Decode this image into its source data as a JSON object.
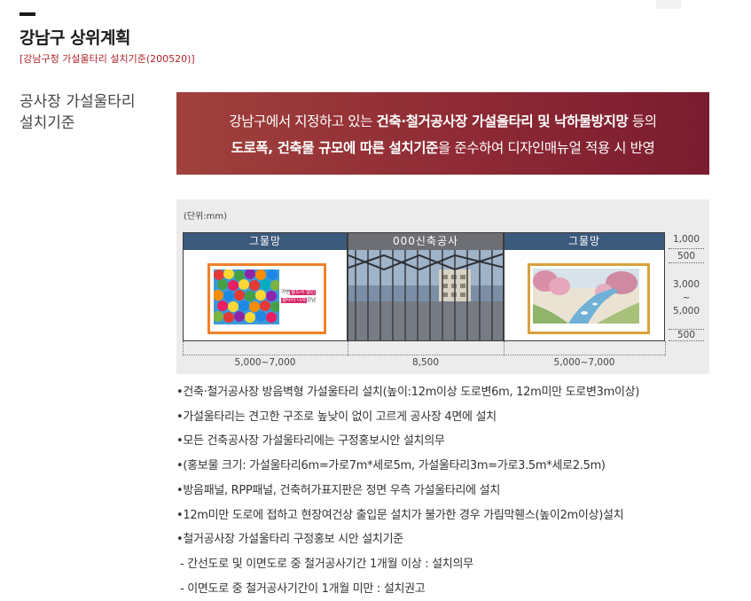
{
  "header": {
    "title": "강남구 상위계획",
    "subtitle": "[강남구청 가설울타리 설치기준(200520)]"
  },
  "section": {
    "label_line1": "공사장 가설울타리",
    "label_line2": "설치기준"
  },
  "banner": {
    "line1_pre": "강남구에서 지정하고 있는 ",
    "line1_bold": "건축·철거공사장 가설울타리 및 낙하물방지망",
    "line1_post": " 등의",
    "line2_bold": "도로폭, 건축물 규모에 따른 설치기준",
    "line2_post": "을 준수하여 디자인매뉴얼 적용 시 반영"
  },
  "diagram": {
    "unit": "(단위:mm)",
    "panels": {
      "left_header": "그물망",
      "mid_header": "000신축공사",
      "right_header": "그물망"
    },
    "left_sign": {
      "text_line1_pre": "가변",
      "text_line1_hl": "울트라 밸런",
      "text_line2_hl": "울타리 디자",
      "text_line2_post": "강남"
    },
    "dims_right": {
      "top": "1,000",
      "a": "500",
      "mid1": "3,000",
      "mid_sep": "~",
      "mid2": "5,000",
      "b": "500"
    },
    "dims_bottom": {
      "left": "5,000~7,000",
      "mid": "8,500",
      "right": "5,000~7,000"
    },
    "colors": {
      "panel_header": "#3b5a7c",
      "sign_left_border": "#f0812a",
      "sign_right_border": "#d9a13b"
    }
  },
  "bullets": [
    "•건축·철거공사장 방음벽형 가설울타리 설치(높이:12m이상 도로변6m, 12m미만 도로변3m이상)",
    "•가설울타리는 견고한 구조로 높낮이 없이 고르게 공사장 4면에 설치",
    "•모든 건축공사장 가설울타리에는 구정홍보시안 설치의무",
    "•(홍보물 크기: 가설울타리6m=가로7m*세로5m, 가설울타리3m=가로3.5m*세로2.5m)",
    "•방음패널, RPP패널, 건축허가표지판은 정면 우측 가설울타리에 설치",
    "•12m미만 도로에 접하고 현장여건상 출입문 설치가 불가한 경우 가림막휀스(높이2m이상)설치",
    "•철거공사장 가설울타리 구정홍보 시안 설치기준",
    " - 간선도로 및 이면도로 중 철거공사기간 1개월 이상 : 설치의무",
    " - 이면도로 중 철거공사기간이 1개월 미만 : 설치권고"
  ]
}
